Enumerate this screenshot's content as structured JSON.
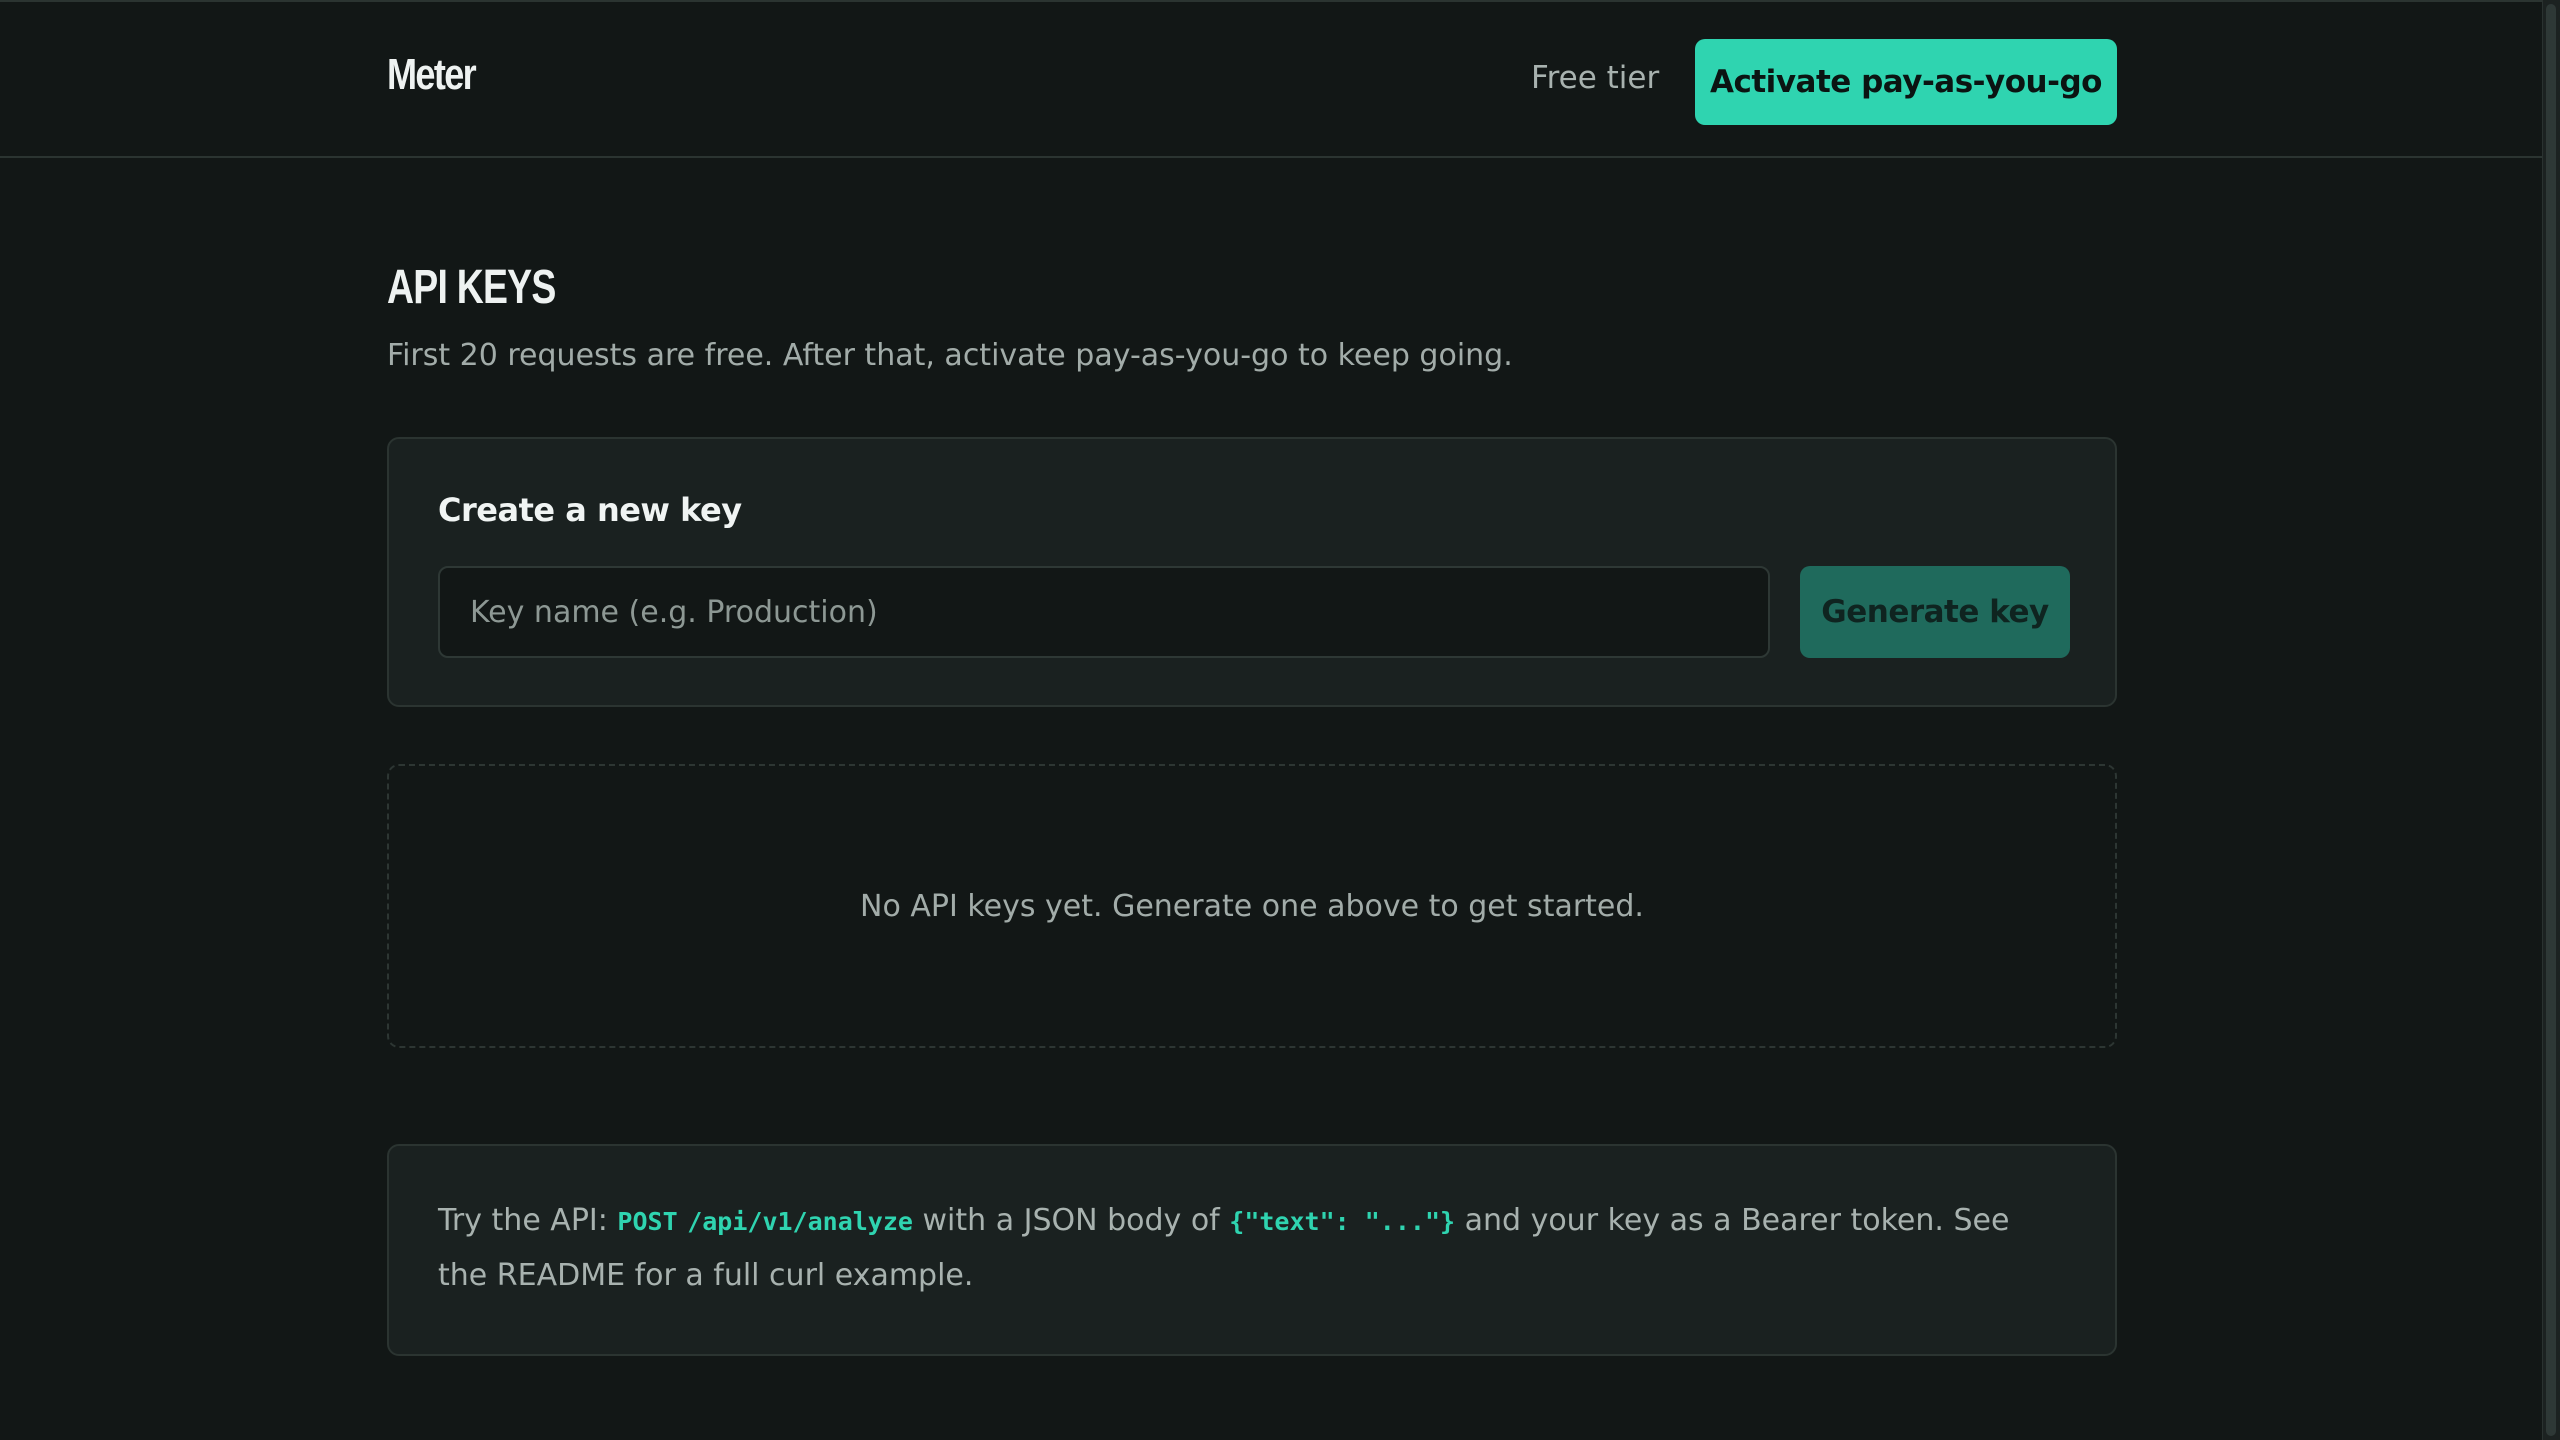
{
  "header": {
    "brand": "Meter",
    "tier_label": "Free tier",
    "cta_label": "Activate pay-as-you-go"
  },
  "page": {
    "title": "API KEYS",
    "subtitle": "First 20 requests are free. After that, activate pay-as-you-go to keep going."
  },
  "create_key": {
    "title": "Create a new key",
    "input_placeholder": "Key name (e.g. Production)",
    "input_value": "",
    "button_label": "Generate key"
  },
  "keys_list": {
    "empty_message": "No API keys yet. Generate one above to get started."
  },
  "api_hint": {
    "prefix": "Try the API: ",
    "method": "POST",
    "path": "/api/v1/analyze",
    "middle": " with a JSON body of ",
    "body_example": "{\"text\": \"...\"}",
    "suffix": " and your key as a Bearer token. See the README for a full curl example."
  },
  "colors": {
    "accent": "#2fd4b0",
    "accent_muted": "#1f6a5c",
    "background": "#121716",
    "card": "#1a2120"
  }
}
